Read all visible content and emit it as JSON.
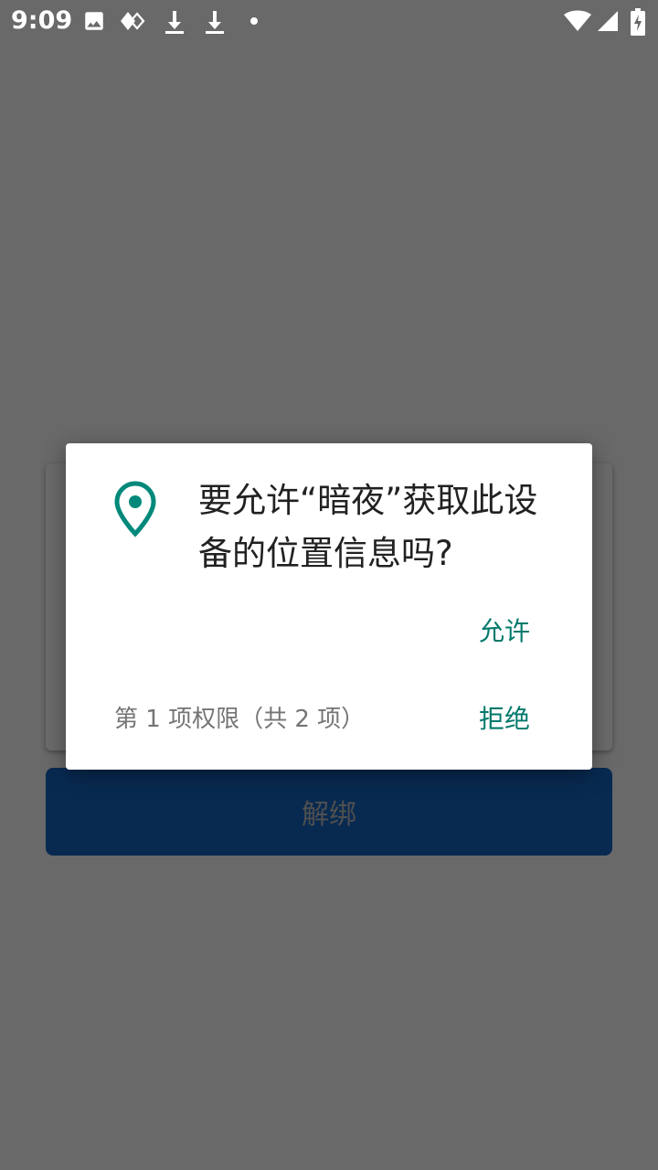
{
  "status_bar": {
    "time": "9:09",
    "icons": [
      "image-icon",
      "media-icon",
      "download-icon",
      "download-icon",
      "dot-icon",
      "wifi-icon",
      "signal-icon",
      "battery-charging-icon"
    ]
  },
  "app": {
    "unbind_label": "解绑"
  },
  "dialog": {
    "title": "要允许“暗夜”获取此设备的位置信息吗?",
    "allow_label": "允许",
    "deny_label": "拒绝",
    "counter": "第 1 项权限（共 2 项）"
  },
  "colors": {
    "accent": "#00796b",
    "unbind_button": "#1565c0",
    "scrim": "#000000"
  }
}
